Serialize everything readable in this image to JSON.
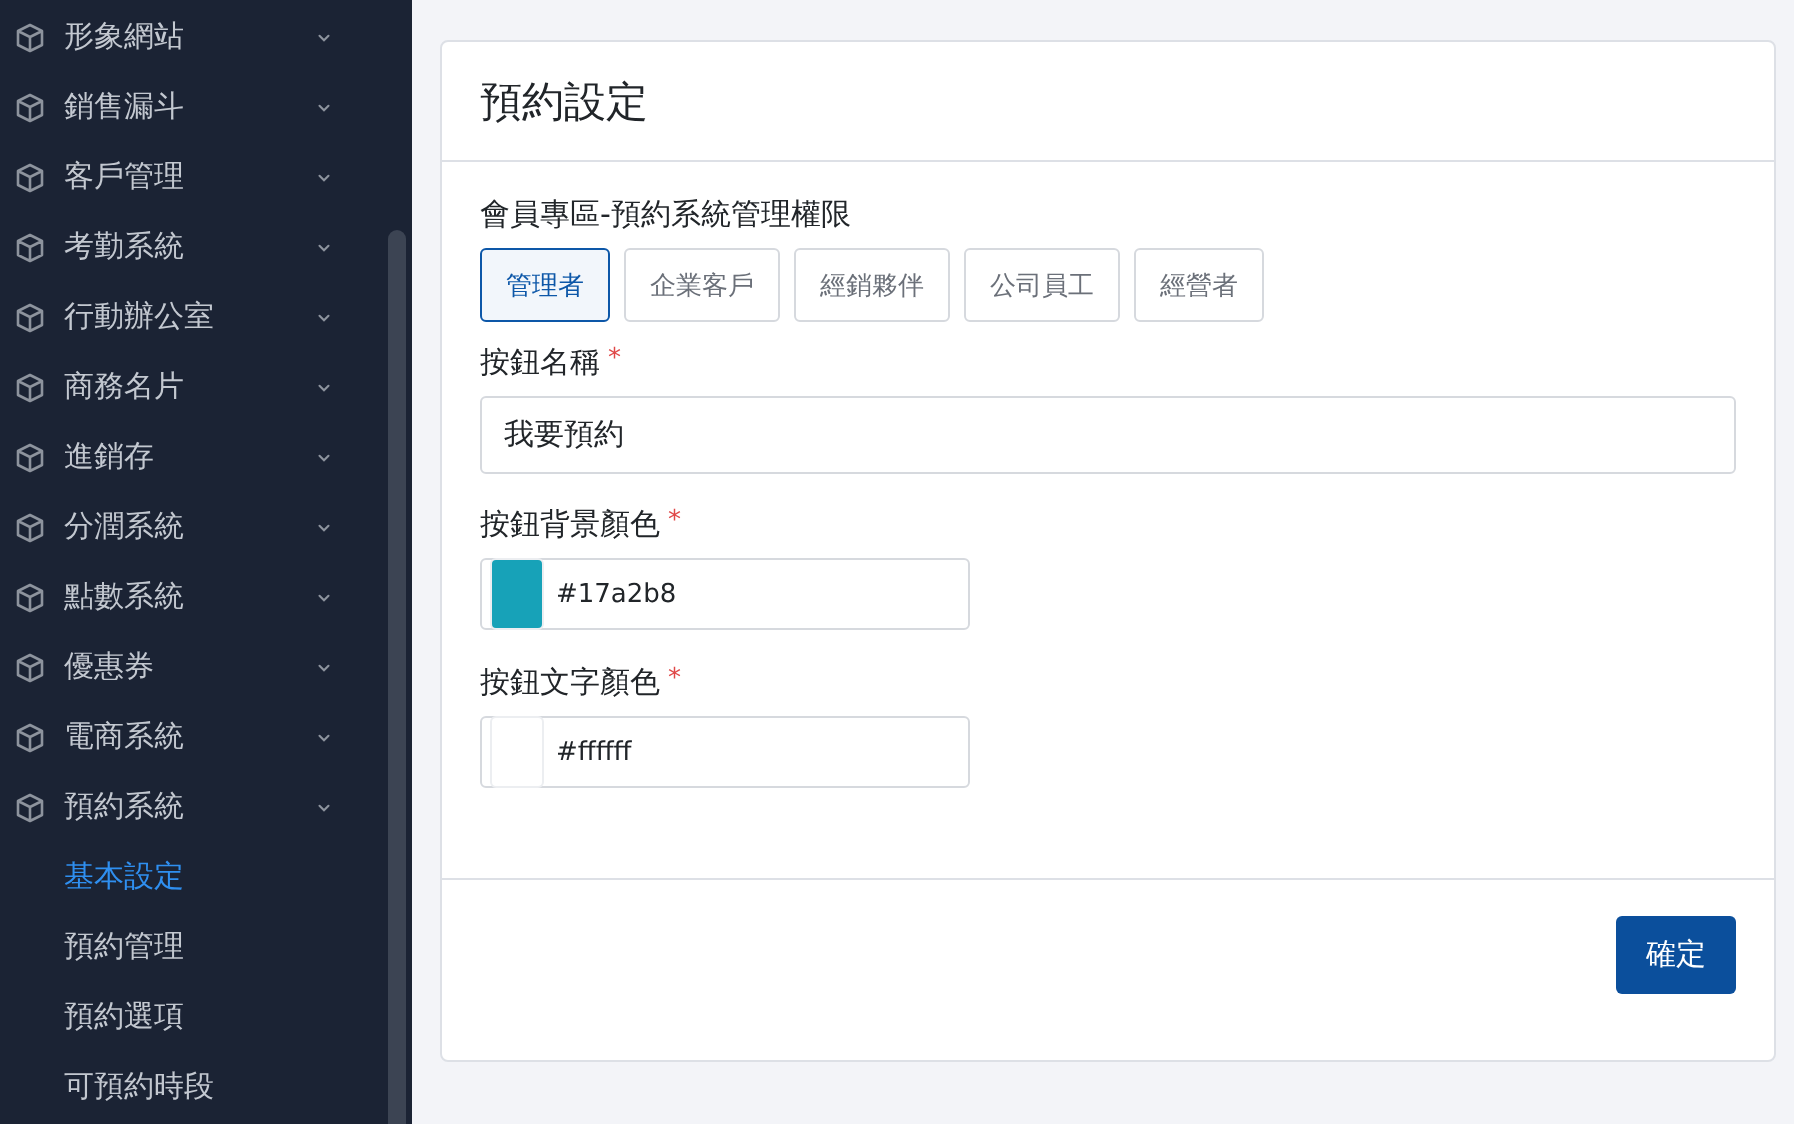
{
  "sidebar": {
    "items": [
      {
        "label": "形象網站"
      },
      {
        "label": "銷售漏斗"
      },
      {
        "label": "客戶管理"
      },
      {
        "label": "考勤系統"
      },
      {
        "label": "行動辦公室"
      },
      {
        "label": "商務名片"
      },
      {
        "label": "進銷存"
      },
      {
        "label": "分潤系統"
      },
      {
        "label": "點數系統"
      },
      {
        "label": "優惠券"
      },
      {
        "label": "電商系統"
      },
      {
        "label": "預約系統",
        "children": [
          {
            "label": "基本設定",
            "selected": true
          },
          {
            "label": "預約管理",
            "selected": false
          },
          {
            "label": "預約選項",
            "selected": false
          },
          {
            "label": "可預約時段",
            "selected": false
          }
        ]
      }
    ]
  },
  "card": {
    "title": "預約設定",
    "permissions": {
      "label": "會員專區-預約系統管理權限",
      "options": [
        {
          "label": "管理者",
          "selected": true
        },
        {
          "label": "企業客戶",
          "selected": false
        },
        {
          "label": "經銷夥伴",
          "selected": false
        },
        {
          "label": "公司員工",
          "selected": false
        },
        {
          "label": "經營者",
          "selected": false
        }
      ]
    },
    "fields": [
      {
        "kind": "text",
        "label": "按鈕名稱",
        "required_mark": "*",
        "value": "我要預約"
      },
      {
        "kind": "color",
        "label": "按鈕背景顏色",
        "required_mark": "*",
        "value": "#17a2b8"
      },
      {
        "kind": "color",
        "label": "按鈕文字顏色",
        "required_mark": "*",
        "value": "#ffffff"
      }
    ],
    "submit": "確定"
  }
}
